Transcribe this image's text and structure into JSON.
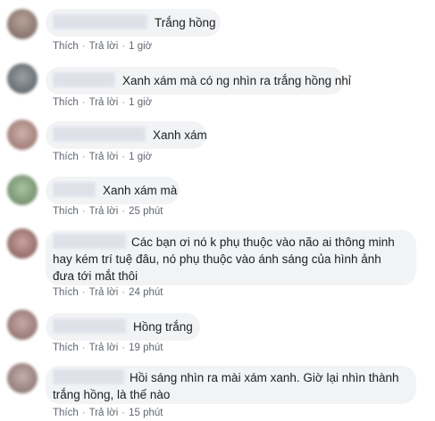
{
  "actions": {
    "like": "Thích",
    "reply": "Trả lời",
    "separator": "·"
  },
  "colors": {
    "bubble": "#f2f3f5",
    "meta_text": "#616770"
  },
  "comments": [
    {
      "text": "Trắng hồng",
      "time": "1 giờ"
    },
    {
      "text": "Xanh xám mà có ng nhìn ra trắng hồng nhỉ",
      "time": "1 giờ"
    },
    {
      "text": "Xanh xám",
      "time": "1 giờ"
    },
    {
      "text": "Xanh xám mà",
      "time": "25 phút"
    },
    {
      "text": "Các bạn ơi nó k phụ thuộc vào não ai thông minh hay kém trí tuệ đâu, nó phụ thuộc vào ánh sáng của hình ảnh đưa tới mắt thôi",
      "time": "24 phút"
    },
    {
      "text": "Hồng trắng",
      "time": "19 phút"
    },
    {
      "text": "Hồi sáng nhìn ra mài xám xanh. Giờ lại nhìn thành trắng hồng, là thế nào",
      "time": "15 phút"
    }
  ]
}
